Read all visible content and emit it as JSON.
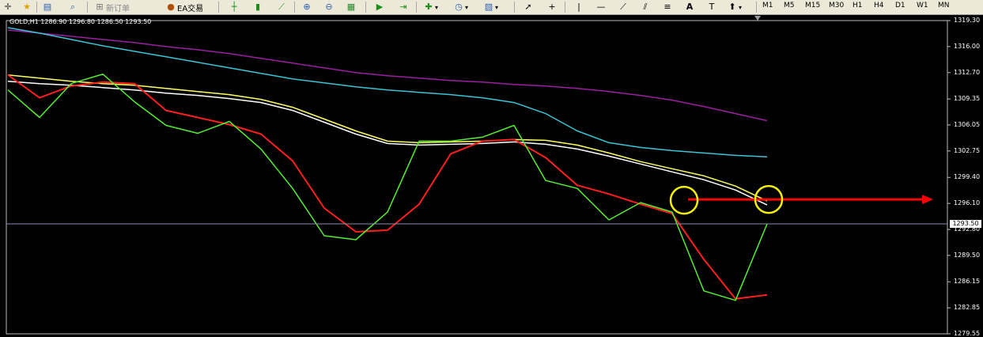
{
  "toolbar": {
    "new_order_label": "新订单",
    "ea_trading_label": "EA交易",
    "icons": [
      "crosshair-icon",
      "favorites-icon",
      "new-chart-icon",
      "zoom-chart-icon",
      "new-order-icon",
      "ea-trading-icon",
      "bar-chart-icon",
      "candles-icon",
      "line-chart-icon",
      "zoom-in-icon",
      "zoom-out-icon",
      "tile-icon",
      "autoscroll-icon",
      "chart-shift-icon",
      "indicators-icon",
      "periods-icon",
      "templates-icon",
      "cursor-icon",
      "crosshair-tool-icon",
      "vertical-line-icon",
      "horizontal-line-icon",
      "trendline-icon",
      "equidistant-channel-icon",
      "fibo-icon",
      "text-icon",
      "text-label-icon",
      "arrows-icon"
    ],
    "timeframes": [
      "M1",
      "M5",
      "M15",
      "M30",
      "H1",
      "H4",
      "D1",
      "W1",
      "MN"
    ]
  },
  "chart_data": {
    "type": "line",
    "symbol_label": "GOLD,H1  1286.90 1296.80 1286.50 1293.50",
    "yticks": [
      "1319.30",
      "1316.00",
      "1312.70",
      "1309.35",
      "1306.05",
      "1302.75",
      "1299.40",
      "1296.10",
      "1292.80",
      "1289.50",
      "1286.15",
      "1282.85",
      "1279.55"
    ],
    "ylim": [
      1279.55,
      1319.3
    ],
    "current_price_label": "1293.50",
    "current_price": 1293.5,
    "x": [
      0,
      40,
      80,
      120,
      160,
      200,
      240,
      280,
      320,
      360,
      400,
      440,
      480,
      520,
      560,
      600,
      640,
      680,
      720,
      760,
      800,
      840,
      880,
      920,
      960
    ],
    "series": [
      {
        "color": "#9b1fa0",
        "values": [
          1318.1,
          1317.7,
          1317.3,
          1316.9,
          1316.5,
          1316.0,
          1315.6,
          1315.1,
          1314.5,
          1313.9,
          1313.3,
          1312.7,
          1312.3,
          1312.0,
          1311.7,
          1311.5,
          1311.2,
          1311.0,
          1310.7,
          1310.3,
          1309.8,
          1309.2,
          1308.4,
          1307.5,
          1306.6
        ]
      },
      {
        "color": "#3cc4d6",
        "values": [
          1318.4,
          1317.7,
          1316.9,
          1316.1,
          1315.4,
          1314.7,
          1314.0,
          1313.3,
          1312.6,
          1311.9,
          1311.4,
          1310.9,
          1310.5,
          1310.2,
          1309.9,
          1309.5,
          1308.9,
          1307.5,
          1305.3,
          1303.8,
          1303.2,
          1302.8,
          1302.5,
          1302.2,
          1302.0
        ]
      },
      {
        "color": "#ffff66",
        "values": [
          1312.4,
          1312.0,
          1311.6,
          1311.3,
          1311.1,
          1310.7,
          1310.3,
          1309.9,
          1309.3,
          1308.3,
          1306.8,
          1305.3,
          1304.0,
          1303.8,
          1303.9,
          1304.0,
          1304.2,
          1304.1,
          1303.5,
          1302.5,
          1301.4,
          1300.5,
          1299.6,
          1298.3,
          1296.4
        ]
      },
      {
        "color": "#ffffff",
        "values": [
          1311.6,
          1311.3,
          1311.1,
          1310.8,
          1310.5,
          1310.1,
          1309.8,
          1309.4,
          1308.9,
          1307.9,
          1306.4,
          1304.9,
          1303.7,
          1303.5,
          1303.6,
          1303.7,
          1303.9,
          1303.6,
          1303.0,
          1302.1,
          1301.1,
          1300.1,
          1299.1,
          1297.8,
          1295.9
        ]
      },
      {
        "color": "#ff1f1f",
        "values": [
          1312.4,
          1309.5,
          1311.0,
          1311.5,
          1311.3,
          1307.9,
          1307.0,
          1306.1,
          1304.9,
          1301.5,
          1295.5,
          1292.5,
          1292.7,
          1296.0,
          1302.4,
          1304.0,
          1304.2,
          1301.9,
          1298.4,
          1297.3,
          1296.0,
          1294.8,
          1289.0,
          1284.0,
          1284.5
        ]
      },
      {
        "color": "#55ee33",
        "values": [
          1310.5,
          1307.0,
          1311.3,
          1312.5,
          1309.0,
          1306.0,
          1305.0,
          1306.5,
          1303.0,
          1298.0,
          1292.0,
          1291.5,
          1295.0,
          1304.0,
          1304.0,
          1304.5,
          1306.0,
          1299.0,
          1298.0,
          1294.0,
          1296.2,
          1295.0,
          1285.0,
          1283.8,
          1293.5
        ]
      }
    ],
    "annotations": {
      "circles": [
        {
          "x": 855,
          "y": 1296.5
        },
        {
          "x": 962,
          "y": 1296.6
        }
      ],
      "arrow": {
        "x1": 860,
        "x2": 1170,
        "y": 1296.6,
        "color": "#ff0000"
      },
      "circle_color": "#f5f000"
    }
  }
}
